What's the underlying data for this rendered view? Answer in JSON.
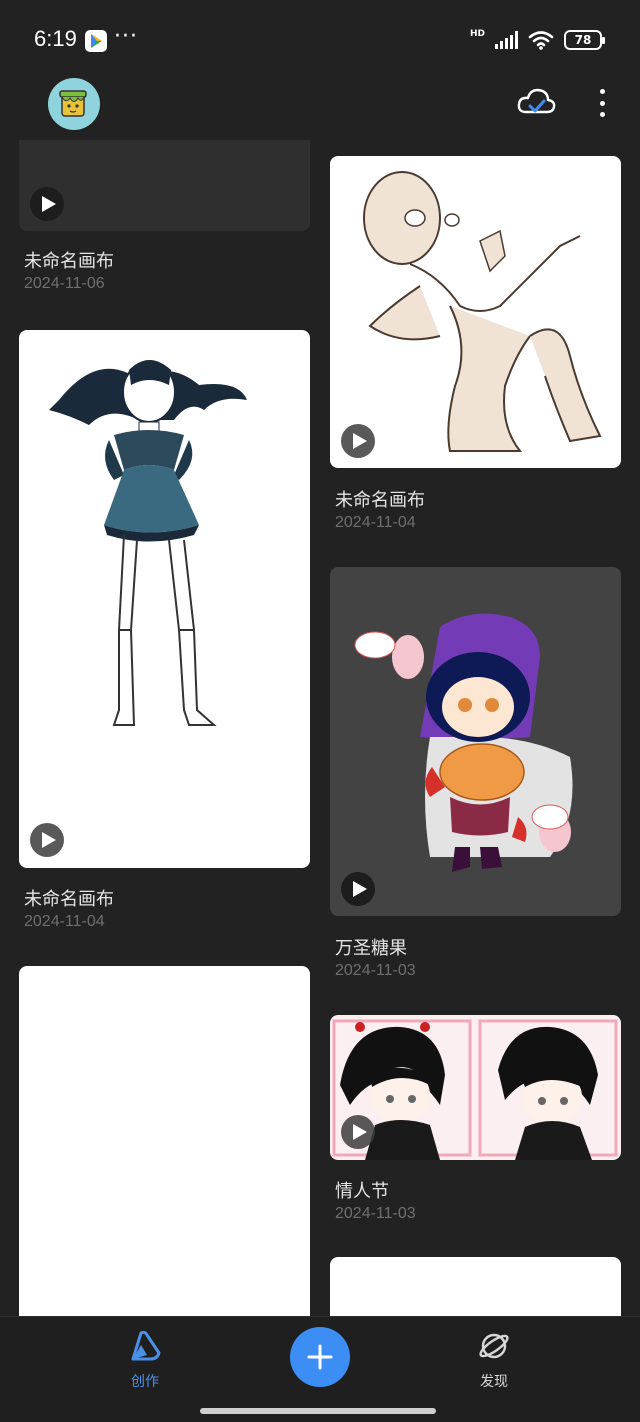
{
  "status_bar": {
    "time": "6:19",
    "hd_label": "HD",
    "battery_level": "78",
    "more_dots": "···"
  },
  "header": {
    "avatar_icon": "paint-bucket-avatar",
    "cloud_icon": "cloud-sync-check-icon",
    "more_icon": "more-vertical-icon"
  },
  "cards": [
    {
      "title": "未命名画布",
      "date": "2024-11-06"
    },
    {
      "title": "未命名画布",
      "date": "2024-11-04"
    },
    {
      "title": "未命名画布",
      "date": "2024-11-04"
    },
    {
      "title": "万圣糖果",
      "date": "2024-11-03"
    },
    {
      "title": "情人节",
      "date": "2024-11-03"
    }
  ],
  "bottom_nav": {
    "create_label": "创作",
    "discover_label": "发现",
    "active_color": "#4a90e8",
    "fab_color": "#3d8ef4"
  }
}
